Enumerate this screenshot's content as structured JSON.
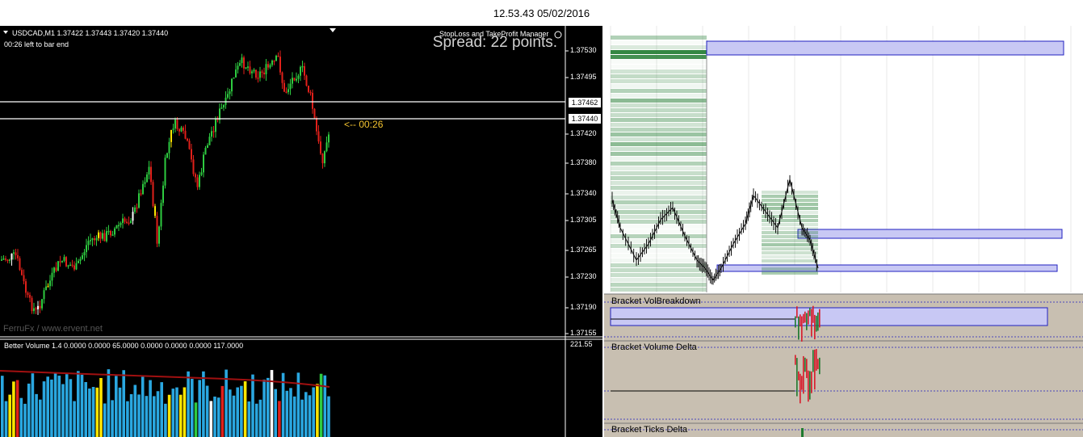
{
  "clock": "12.53.43 05/02/2016",
  "chart": {
    "symbol_header": "USDCAD,M1  1.37422 1.37443 1.37420 1.37440",
    "bar_end": "00:26 left to bar end",
    "sl_tp_manager": "StopLoss and TakeProfit Manager",
    "spread": "Spread: 22 points.",
    "countdown": "<-- 00:26",
    "watermark": "FerruFx / www.ervent.net",
    "price_labels": [
      "1.37530",
      "1.37495",
      "1.37420",
      "1.37380",
      "1.37340",
      "1.37305",
      "1.37265",
      "1.37230",
      "1.37190",
      "1.37155"
    ],
    "line_labels": [
      "1.37462",
      "1.37440"
    ],
    "volume_header": "Better Volume 1.4 0.0000 0.0000 65.0000 0.0000 0.0000 0.0000 117.0000",
    "volume_max": "221.55",
    "colors": {
      "bg": "#000000",
      "bull": "#2ecc40",
      "bear": "#e0201a",
      "vol": "#2aa7e0",
      "climax": "#ffffff",
      "lowvol": "#ffe600"
    }
  },
  "panel": {
    "vol_breakdown": "Bracket VolBreakdown",
    "volume_delta": "Bracket Volume Delta",
    "ticks_delta": "Bracket Ticks Delta",
    "colors": {
      "profile": "#1e7a2e",
      "box_fill": "#c8c8f4",
      "box_stroke": "#2020c0",
      "sub_bg": "#c8bfb1"
    }
  }
}
